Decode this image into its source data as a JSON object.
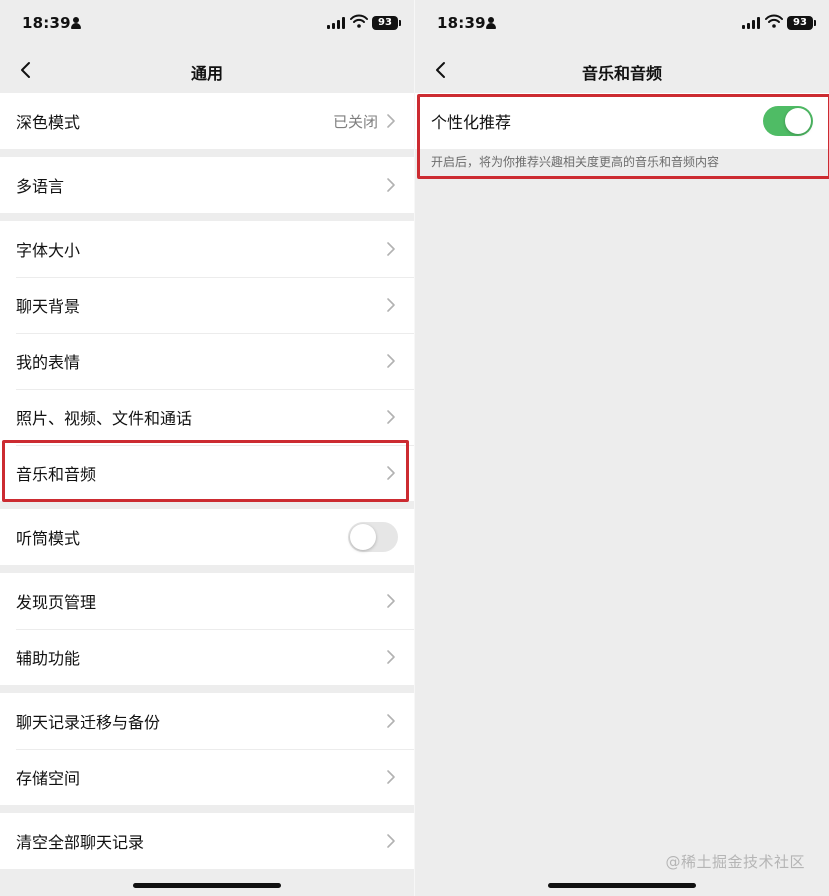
{
  "status_bar": {
    "time": "18:39",
    "battery": "93"
  },
  "left_screen": {
    "title": "通用",
    "groups": [
      {
        "items": [
          {
            "label": "深色模式",
            "value": "已关闭"
          }
        ]
      },
      {
        "items": [
          {
            "label": "多语言"
          }
        ]
      },
      {
        "items": [
          {
            "label": "字体大小"
          },
          {
            "label": "聊天背景"
          },
          {
            "label": "我的表情"
          },
          {
            "label": "照片、视频、文件和通话"
          },
          {
            "label": "音乐和音频",
            "highlighted": true
          }
        ]
      },
      {
        "items": [
          {
            "label": "听筒模式",
            "toggle": "off"
          }
        ]
      },
      {
        "items": [
          {
            "label": "发现页管理"
          },
          {
            "label": "辅助功能"
          }
        ]
      },
      {
        "items": [
          {
            "label": "聊天记录迁移与备份"
          },
          {
            "label": "存储空间"
          }
        ]
      },
      {
        "items": [
          {
            "label": "清空全部聊天记录"
          }
        ]
      }
    ]
  },
  "right_screen": {
    "title": "音乐和音频",
    "setting": {
      "label": "个性化推荐",
      "toggle": "on",
      "description": "开启后，将为你推荐兴趣相关度更高的音乐和音频内容"
    }
  },
  "colors": {
    "highlight": "#cc2b31",
    "toggle_on": "#4fbc65",
    "background": "#ededed"
  },
  "watermark": "@稀土掘金技术社区"
}
